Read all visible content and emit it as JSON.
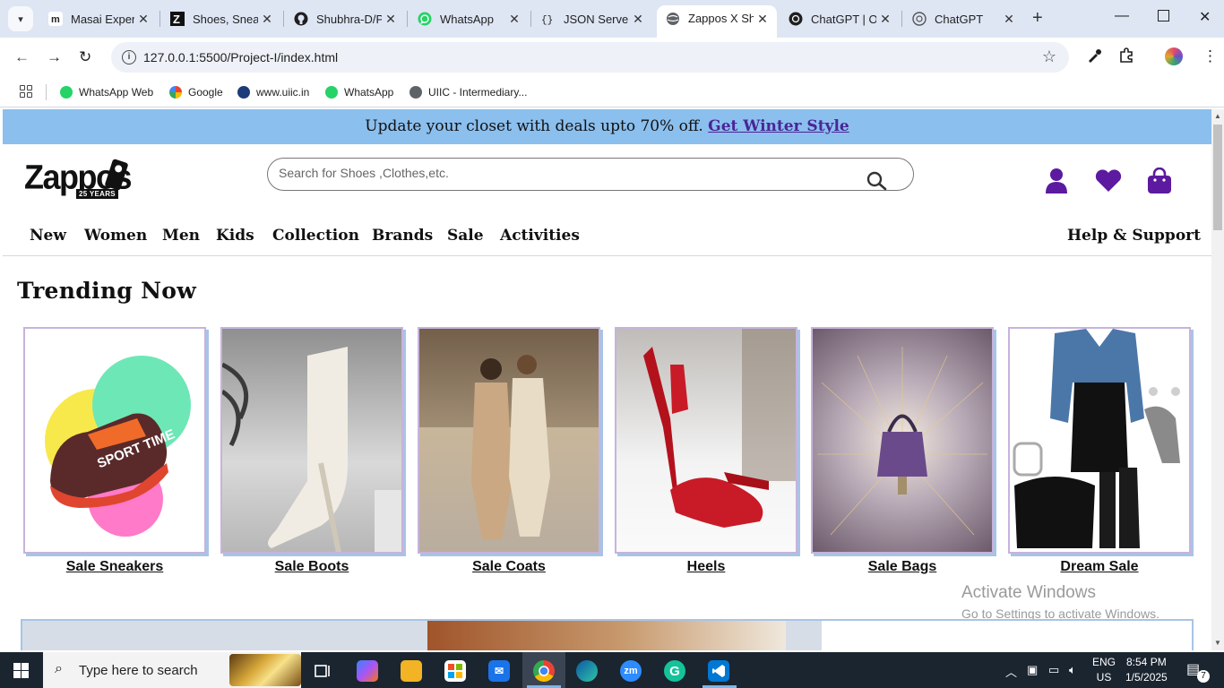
{
  "browser": {
    "tabs": [
      {
        "title": "Masai Experi",
        "favicon": "masai-m-icon"
      },
      {
        "title": "Shoes, Sneak",
        "favicon": "zappos-z-icon"
      },
      {
        "title": "Shubhra-D/P",
        "favicon": "github-icon"
      },
      {
        "title": "WhatsApp",
        "favicon": "whatsapp-icon"
      },
      {
        "title": "JSON Server",
        "favicon": "json-server-icon"
      },
      {
        "title": "Zappos X Sh",
        "favicon": "globe-icon",
        "active": true
      },
      {
        "title": "ChatGPT | O",
        "favicon": "openai-icon"
      },
      {
        "title": "ChatGPT",
        "favicon": "openai-icon"
      }
    ],
    "url": "127.0.0.1:5500/Project-I/index.html",
    "bookmarks": [
      {
        "label": "WhatsApp Web",
        "icon": "whatsapp-icon"
      },
      {
        "label": "Google",
        "icon": "google-icon"
      },
      {
        "label": "www.uiic.in",
        "icon": "uiic-icon"
      },
      {
        "label": "WhatsApp",
        "icon": "whatsapp-icon"
      },
      {
        "label": "UIIC - Intermediary...",
        "icon": "globe-icon"
      }
    ]
  },
  "page": {
    "promo": {
      "text": "Update your closet with deals upto 70% off.",
      "link": "Get Winter Style"
    },
    "logo": {
      "text": "Zappos",
      "badge": "25 YEARS"
    },
    "search": {
      "placeholder": "Search for Shoes ,Clothes,etc."
    },
    "nav": [
      "New",
      "Women",
      "Men",
      "Kids",
      "Collection",
      "Brands",
      "Sale",
      "Activities"
    ],
    "help": "Help & Support",
    "section_title": "Trending Now",
    "cards": [
      {
        "label": "Sale Sneakers"
      },
      {
        "label": "Sale Boots"
      },
      {
        "label": "Sale Coats"
      },
      {
        "label": "Heels"
      },
      {
        "label": "Sale Bags"
      },
      {
        "label": "Dream Sale"
      }
    ],
    "sneaker_text": "SPORT TIME",
    "colors": {
      "promo_bg": "#8bbfee",
      "link": "#4a2596",
      "icon_purple": "#5b1a9f"
    }
  },
  "os": {
    "watermark_title": "Activate Windows",
    "watermark_sub": "Go to Settings to activate Windows.",
    "search_placeholder": "Type here to search",
    "lang_top": "ENG",
    "lang_bottom": "US",
    "time": "8:54 PM",
    "date": "1/5/2025",
    "notifications": "7"
  }
}
